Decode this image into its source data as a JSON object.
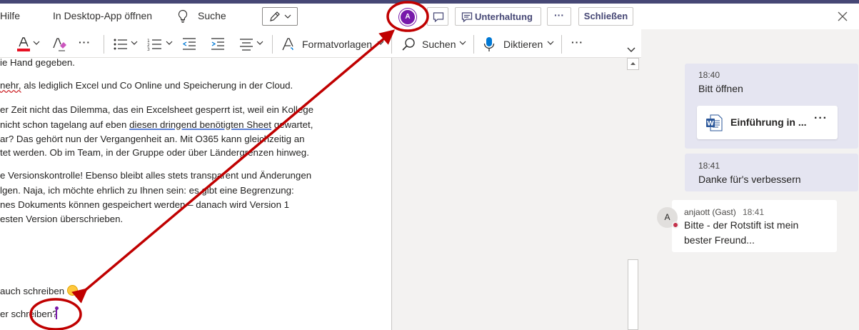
{
  "topbar": {
    "help": "Hilfe",
    "open_desktop": "In Desktop-App öffnen",
    "search": "Suche",
    "avatar_initial": "A",
    "conversation": "Unterhaltung",
    "more": "···",
    "close": "Schließen"
  },
  "ribbon": {
    "styles": "Formatvorlagen",
    "find": "Suchen",
    "dictate": "Diktieren",
    "more": "···"
  },
  "document": {
    "lines": [
      "ie Hand gegeben.",
      "als lediglich Excel und Co Online und Speicherung in der Cloud.",
      "er Zeit nicht das Dilemma, das ein Excelsheet gesperrt ist, weil ein Kollege",
      "nicht schon tagelang auf eben ",
      "ar? Das gehört nun der Vergangenheit an. Mit O365 kann gleichzeitig an",
      "tet werden. Ob im Team, in der Gruppe oder über Ländergrenzen hinweg.",
      "e Versionskontrolle! Ebenso bleibt alles stets transparent und Änderungen",
      "lgen. Naja, ich möchte ehrlich zu Ihnen sein: es gibt eine Begrenzung:",
      "nes Dokuments können gespeichert werden – danach wird Version 1",
      "esten Version überschrieben.",
      "auch schreiben",
      "er schreiben?"
    ],
    "line2_prefix": "nehr,",
    "line4_underlined": "diesen dringend benötigten Sheet",
    "line4_suffix": " gewartet,"
  },
  "chat": {
    "messages": [
      {
        "time": "18:40",
        "text": "Bitt öffnen",
        "attachment": "Einführung in ...",
        "attachment_more": "···"
      },
      {
        "time": "18:41",
        "text": "Danke für's verbessern"
      }
    ],
    "reply": {
      "avatar_initial": "A",
      "author": "anjaott (Gast)",
      "time": "18:41",
      "line1": "Bitte - der Rotstift ist mein",
      "line2": "bester Freund..."
    }
  },
  "colors": {
    "teams_purple": "#464775",
    "avatar_purple": "#7719aa",
    "annotation_red": "#c00000",
    "presence_busy": "#c4314b"
  }
}
